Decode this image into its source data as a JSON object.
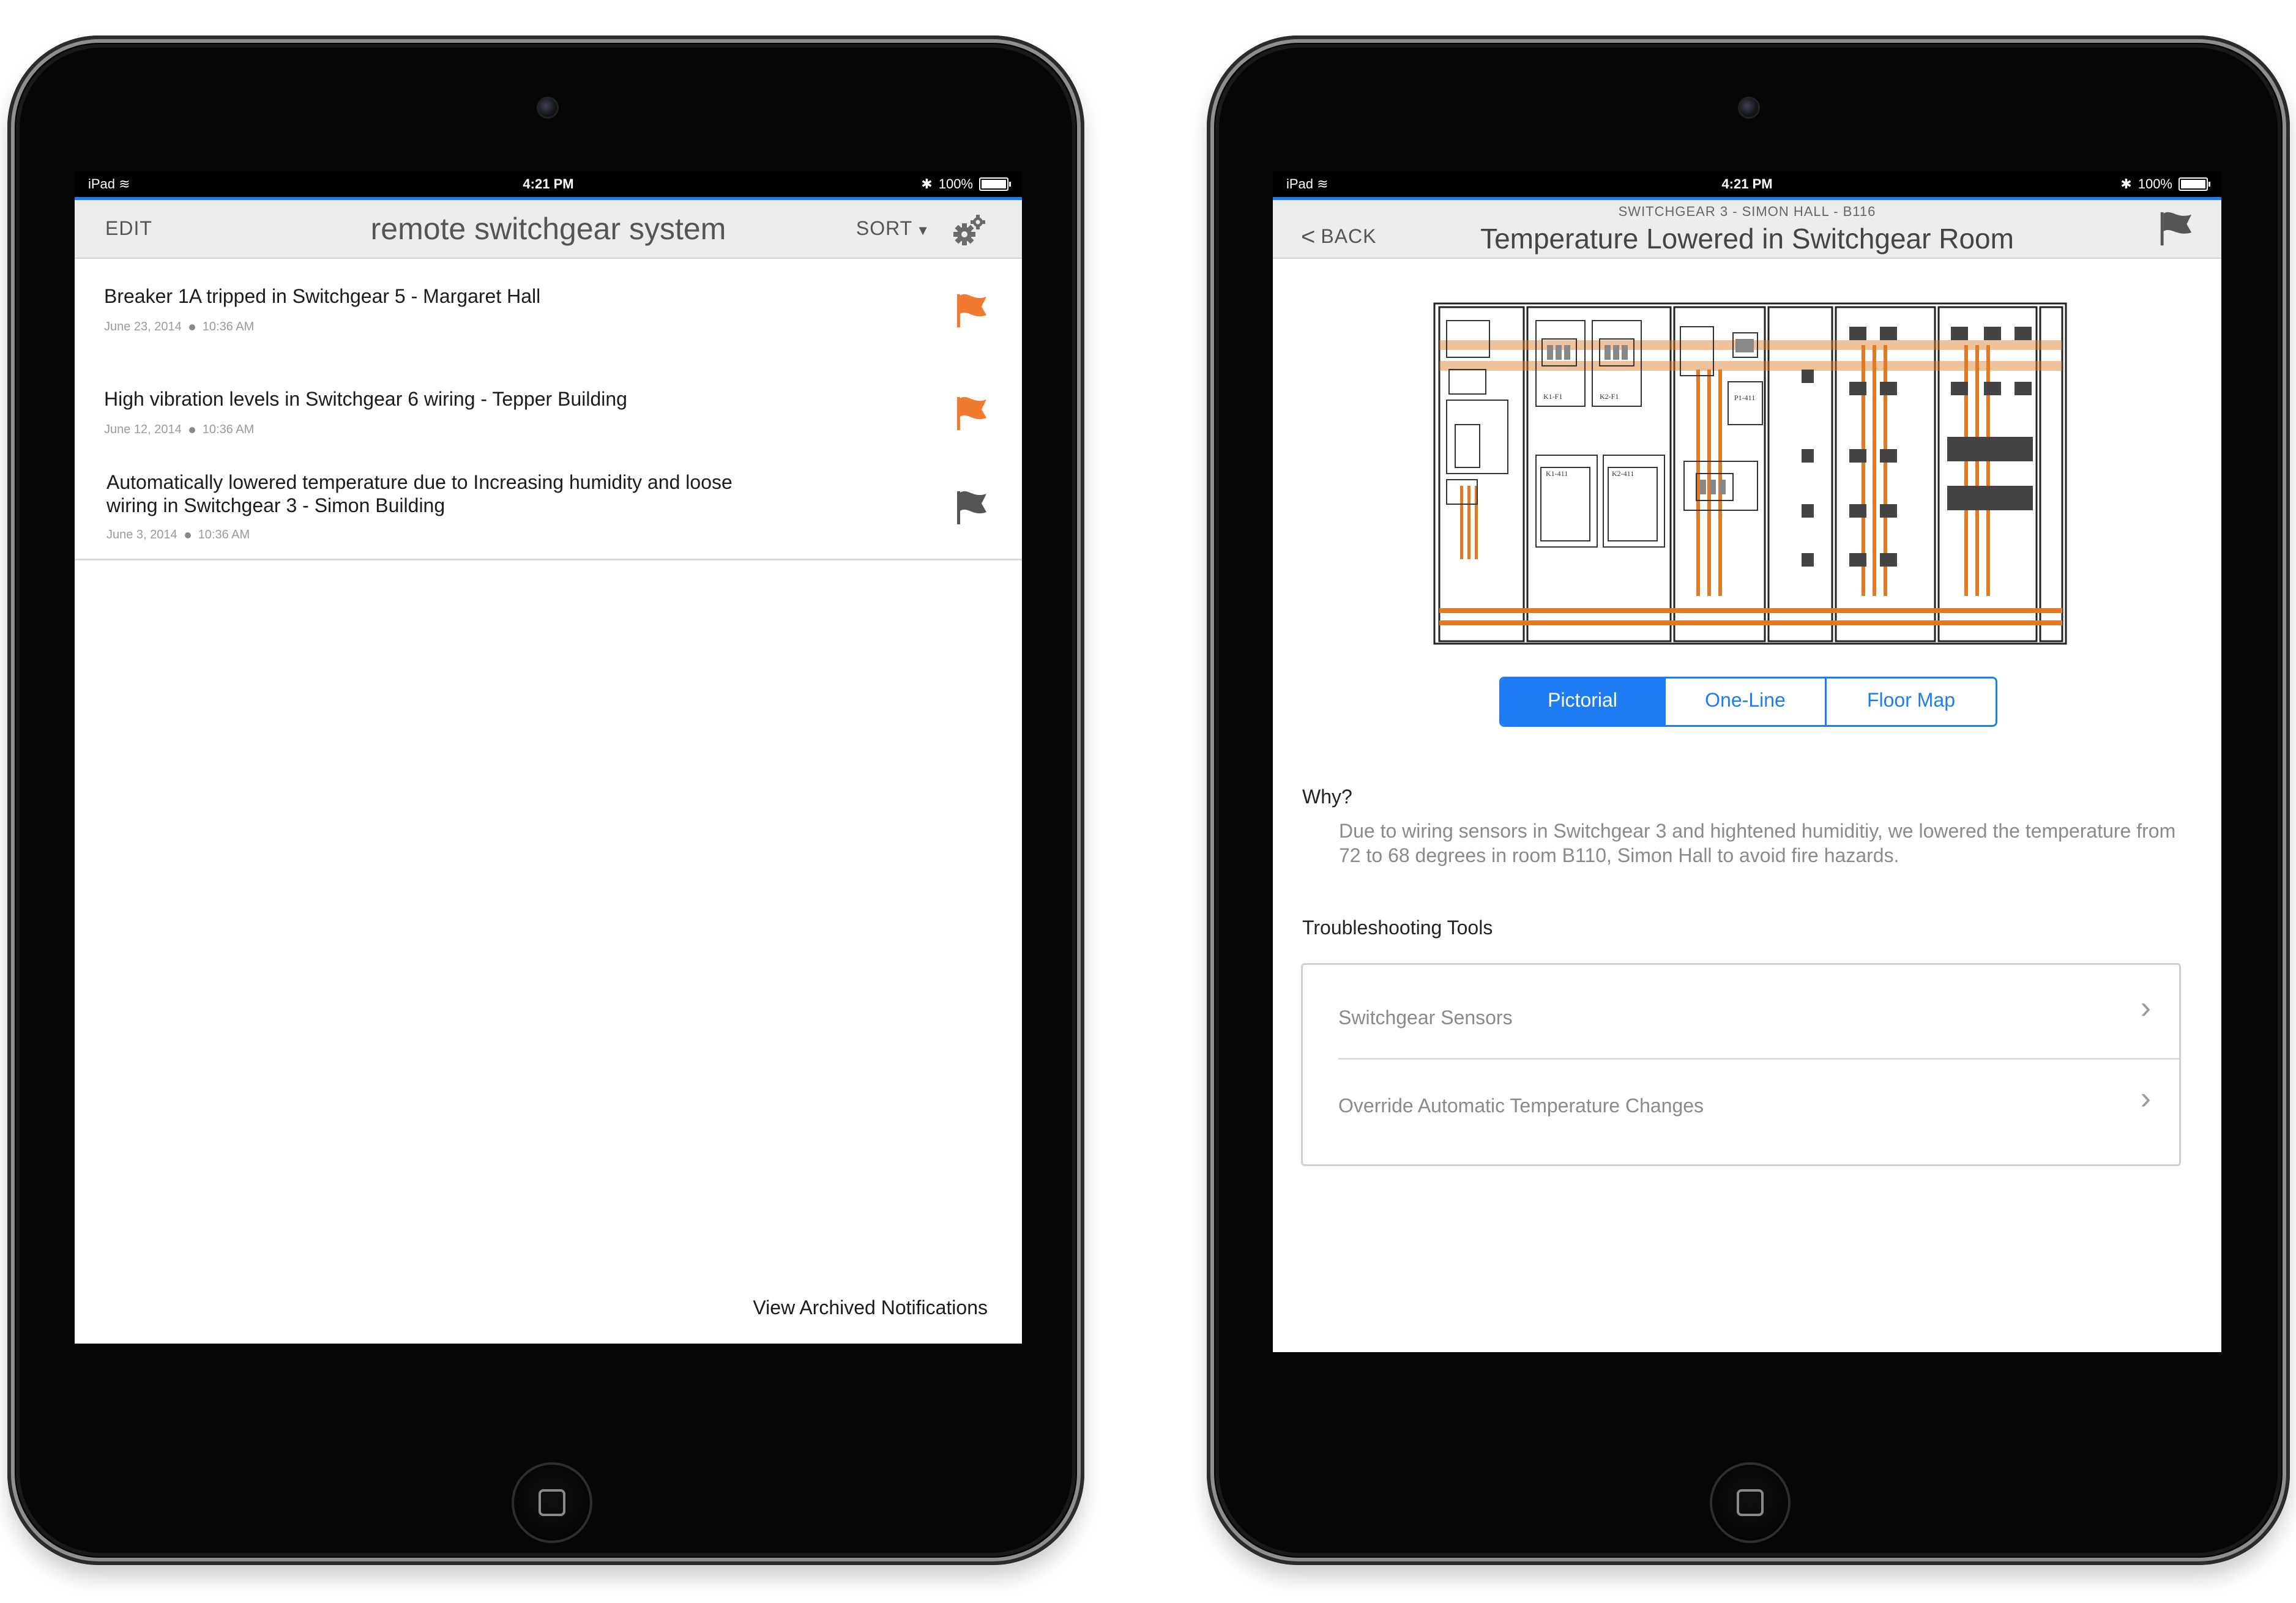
{
  "status_bar": {
    "device": "iPad",
    "time": "4:21 PM",
    "battery": "100%"
  },
  "left_screen": {
    "nav": {
      "edit_label": "EDIT",
      "title": "remote switchgear system",
      "sort_label": "SORT"
    },
    "notifications": [
      {
        "title_lines": [
          "Breaker 1A tripped in Switchgear 5 - Margaret Hall"
        ],
        "date": "June 23, 2014",
        "time": "10:36 AM",
        "flag_color": "#f07a32"
      },
      {
        "title_lines": [
          "High vibration levels in Switchgear 6 wiring - Tepper Building"
        ],
        "date": "June 12, 2014",
        "time": "10:36 AM",
        "flag_color": "#f07a32"
      },
      {
        "title_lines": [
          "Automatically lowered temperature due to Increasing humidity and loose",
          "wiring in Switchgear 3 - Simon Building"
        ],
        "date": "June 3, 2014",
        "time": "10:36 AM",
        "flag_color": "#555555"
      }
    ],
    "archived_link": "View Archived Notifications"
  },
  "right_screen": {
    "nav": {
      "back_label": "BACK",
      "subtitle": "SWITCHGEAR 3 - SIMON HALL - B116",
      "title": "Temperature Lowered in Switchgear Room"
    },
    "diagram_labels": [
      "K1-F1",
      "K2-F1",
      "K1-411",
      "K2-411",
      "P1-411"
    ],
    "tabs": [
      "Pictorial",
      "One-Line",
      "Floor Map"
    ],
    "selected_tab": "Pictorial",
    "why": {
      "heading": "Why?",
      "text": "Due to wiring sensors in Switchgear 3 and hightened humiditiy, we lowered the temperature from 72 to 68 degrees in room B110, Simon Hall to avoid fire hazards."
    },
    "tools": {
      "heading": "Troubleshooting Tools",
      "items": [
        "Switchgear Sensors",
        "Override Automatic Temperature Changes"
      ]
    }
  },
  "colors": {
    "accent": "#1e7cf2",
    "alert_flag": "#f07a32",
    "resolved_flag": "#555555",
    "busbar": "#e07a24"
  }
}
